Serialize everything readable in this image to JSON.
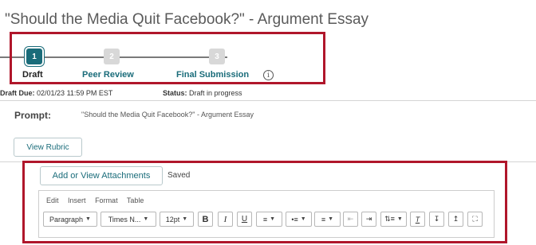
{
  "page": {
    "title": "\"Should the Media Quit Facebook?\" - Argument Essay"
  },
  "steps": [
    {
      "number": "1",
      "label": "Draft"
    },
    {
      "number": "2",
      "label": "Peer Review"
    },
    {
      "number": "3",
      "label": "Final Submission"
    }
  ],
  "meta": {
    "due_label": "Draft Due:",
    "due_value": "02/01/23 11:59 PM EST",
    "status_label": "Status:",
    "status_value": "Draft in progress"
  },
  "prompt": {
    "label": "Prompt:",
    "text": "\"Should the Media Quit Facebook?\" - Argument Essay"
  },
  "buttons": {
    "view_rubric": "View Rubric",
    "attachments": "Add or View Attachments",
    "saved": "Saved"
  },
  "editor": {
    "menu": [
      "Edit",
      "Insert",
      "Format",
      "Table"
    ],
    "block_format": "Paragraph",
    "font_family": "Times N...",
    "font_size": "12pt",
    "bold": "B",
    "italic": "I",
    "underline": "U"
  },
  "colors": {
    "accent": "#1a6c7a",
    "highlight": "#b0162b"
  },
  "icons": [
    "info-icon",
    "align-icon",
    "bullet-list-icon",
    "numbered-list-icon",
    "outdent-icon",
    "indent-icon",
    "line-spacing-icon",
    "clear-format-icon",
    "download-icon",
    "upload-icon",
    "fullscreen-icon"
  ]
}
